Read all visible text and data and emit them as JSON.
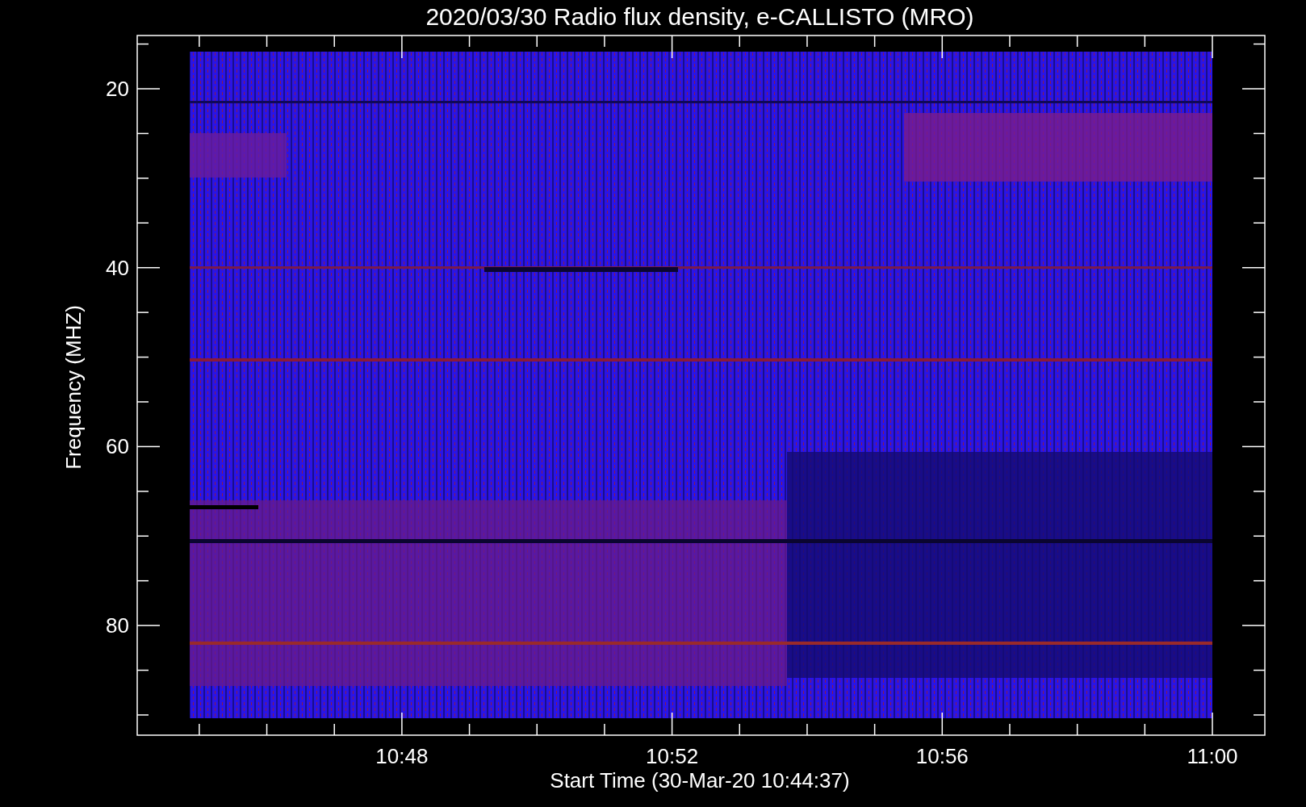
{
  "title": "2020/03/30  Radio flux density, e-CALLISTO (MRO)",
  "y_axis": {
    "label": "Frequency (MHZ)",
    "ticks": [
      "20",
      "40",
      "60",
      "80"
    ]
  },
  "x_axis": {
    "label": "Start Time (30-Mar-20 10:44:37)",
    "ticks": [
      "10:48",
      "10:52",
      "10:56",
      "11:00"
    ]
  }
}
